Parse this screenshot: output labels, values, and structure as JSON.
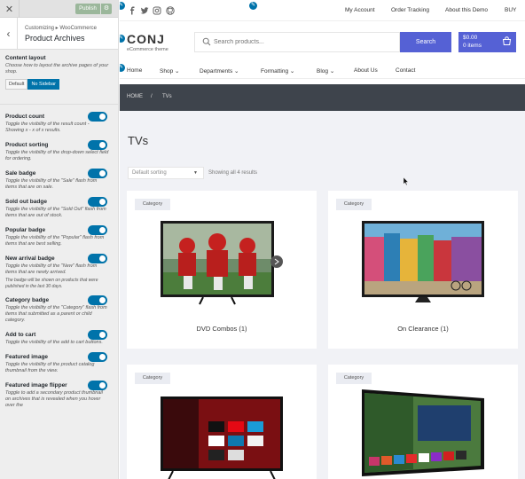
{
  "customizer": {
    "publish_label": "Publish",
    "breadcrumb": "Customizing ▸ WooCommerce",
    "title": "Product Archives",
    "content_layout": {
      "title": "Content layout",
      "description": "Choose how to layout the archive pages of your shop.",
      "options": [
        "Default",
        "No Sidebar"
      ],
      "selected": "No Sidebar"
    },
    "toggles": [
      {
        "title": "Product count",
        "description": "Toggle the visibility of the result count - Showing x - x of x results.",
        "on": true
      },
      {
        "title": "Product sorting",
        "description": "Toggle the visibility of the drop-down select field for ordering.",
        "on": true
      },
      {
        "title": "Sale badge",
        "description": "Toggle the visibility of the \"Sale\" flash from items that are on sale.",
        "on": true
      },
      {
        "title": "Sold out badge",
        "description": "Toggle the visibility of the \"Sold Out\" flash from items that are out of stock.",
        "on": true
      },
      {
        "title": "Popular badge",
        "description": "Toggle the visibility of the \"Popular\" flash from items that are best selling.",
        "on": true
      },
      {
        "title": "New arrival badge",
        "description": "Toggle the visibility of the \"New\" flash from items that are newly arrived.",
        "note": "The badge will be shown on products that were published in the last 30 days.",
        "on": true
      },
      {
        "title": "Category badge",
        "description": "Toggle the visibility of the \"Category\" flash from items that submitted as a parent or child category.",
        "on": true
      },
      {
        "title": "Add to cart",
        "description": "Toggle the visibility of the add to cart buttons.",
        "on": true
      },
      {
        "title": "Featured image",
        "description": "Toggle the visibility of the product catalog thumbnail from the view.",
        "on": true
      },
      {
        "title": "Featured image flipper",
        "description": "Toggle to add a secondary product thumbnail on archives that is revealed when you hover over the",
        "on": true
      }
    ]
  },
  "site": {
    "top_links": [
      "My Account",
      "Order Tracking",
      "About this Demo",
      "BUY"
    ],
    "social_icons": [
      "facebook-icon",
      "twitter-icon",
      "instagram-icon",
      "github-icon"
    ],
    "logo": "CONJ",
    "logo_sub": "eCommerce theme",
    "search": {
      "placeholder": "Search products...",
      "button": "Search"
    },
    "cart": {
      "amount": "$0.00",
      "items": "0 items"
    },
    "nav": [
      "Home",
      "Shop",
      "Departments",
      "Formatting",
      "Blog",
      "About Us",
      "Contact"
    ],
    "breadcrumb": [
      "HOME",
      "/",
      "TVs"
    ],
    "page_title": "TVs",
    "sorting": "Default sorting",
    "result_count": "Showing all 4 results",
    "products": [
      {
        "category": "Category",
        "name": "DVD Combos",
        "count": "(1)"
      },
      {
        "category": "Category",
        "name": "On Clearance",
        "count": "(1)"
      },
      {
        "category": "Category",
        "name": "",
        "count": ""
      },
      {
        "category": "Category",
        "name": "",
        "count": ""
      }
    ]
  },
  "colors": {
    "accent": "#5561d5",
    "wp_blue": "#0073aa",
    "breadcrumb_bg": "#3e444c",
    "content_bg": "#f1f2f6"
  }
}
